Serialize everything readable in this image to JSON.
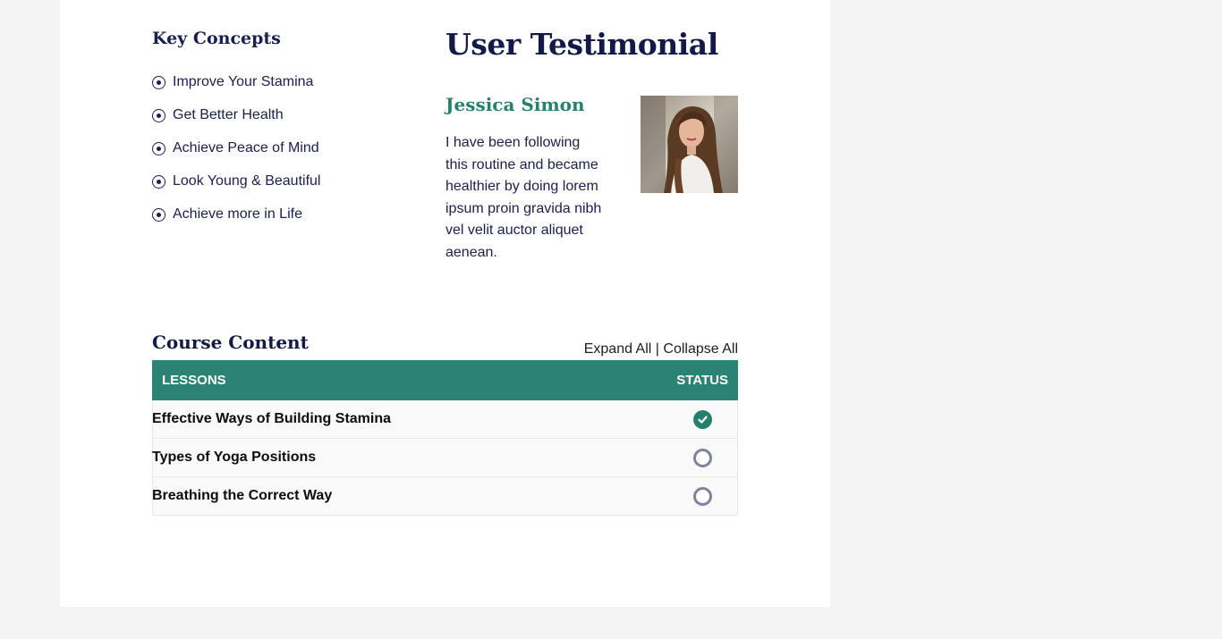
{
  "key_concepts": {
    "title": "Key Concepts",
    "items": [
      {
        "label": "Improve Your Stamina",
        "icon": "circle-dot-icon"
      },
      {
        "label": "Get Better Health",
        "icon": "circle-dot-icon"
      },
      {
        "label": "Achieve Peace of Mind",
        "icon": "circle-dot-icon"
      },
      {
        "label": "Look Young & Beautiful",
        "icon": "circle-dot-icon"
      },
      {
        "label": "Achieve more in Life",
        "icon": "circle-dot-icon"
      }
    ]
  },
  "testimonial": {
    "title": "User Testimonial",
    "name": "Jessica Simon",
    "quote": "I have been following this routine and became healthier by doing lorem ipsum proin gravida nibh vel velit auctor aliquet aenean.",
    "avatar": "woman-portrait-photo"
  },
  "course": {
    "title": "Course Content",
    "expand_label": "Expand All",
    "separator": "|",
    "collapse_label": "Collapse All",
    "columns": {
      "lessons": "LESSONS",
      "status": "STATUS"
    },
    "lessons": [
      {
        "title": "Effective Ways of Building Stamina",
        "status": "complete",
        "icon": "check-circle-icon"
      },
      {
        "title": "Types of Yoga Positions",
        "status": "incomplete",
        "icon": "empty-circle-icon"
      },
      {
        "title": "Breathing the Correct Way",
        "status": "incomplete",
        "icon": "empty-circle-icon"
      }
    ]
  },
  "colors": {
    "accent": "#2a8373",
    "heading": "#141a47",
    "page_background": "#f4f4f4",
    "card_background": "#ffffff",
    "incomplete_ring": "#7e839b"
  }
}
